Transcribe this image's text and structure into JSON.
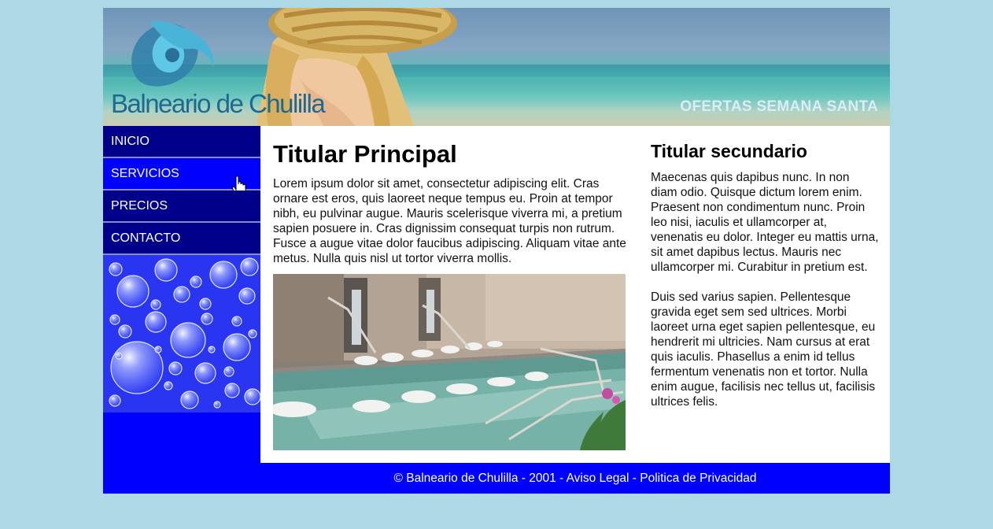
{
  "header": {
    "logo_text": "Balneario de Chulilla",
    "offers_link": "OFERTAS SEMANA SANTA"
  },
  "nav": {
    "items": [
      {
        "label": "INICIO",
        "active": false
      },
      {
        "label": "SERVICIOS",
        "active": true
      },
      {
        "label": "PRECIOS",
        "active": false
      },
      {
        "label": "CONTACTO",
        "active": false
      }
    ]
  },
  "main": {
    "title": "Titular Principal",
    "paragraph": "Lorem ipsum dolor sit amet, consectetur adipiscing elit. Cras ornare est eros, quis laoreet neque tempus eu. Proin at tempor nibh, eu pulvinar augue. Mauris scelerisque viverra mi, a pretium sapien posuere in. Cras dignissim consequat turpis non rutrum. Fusce a augue vitae dolor faucibus adipiscing. Aliquam vitae ante metus. Nulla quis nisl ut tortor viverra mollis."
  },
  "aside": {
    "title": "Titular secundario",
    "paragraphs": [
      "Maecenas quis dapibus nunc. In non diam odio. Quisque dictum lorem enim. Praesent non condimentum nunc. Proin leo nisi, iaculis et ullamcorper at, venenatis eu dolor. Integer eu mattis urna, sit amet dapibus lectus. Mauris nec ullamcorper mi. Curabitur in pretium est.",
      "Duis sed varius sapien. Pellentesque gravida eget sem sed ultrices. Morbi laoreet urna eget sapien pellentesque, eu hendrerit mi ultricies. Nam cursus at erat quis iaculis. Phasellus a enim id tellus fermentum venenatis non et tortor. Nulla enim augue, facilisis nec tellus ut, facilisis ultrices felis."
    ]
  },
  "footer": {
    "text": "© Balneario de Chulilla - 2001 - Aviso Legal - Politica de Privacidad"
  },
  "colors": {
    "background": "#add8e6",
    "nav_bg": "#00008b",
    "nav_active": "#0000ff",
    "footer_bg": "#0000ff"
  },
  "icons": {
    "logo": "swirl-logo-icon",
    "cursor": "hand-pointer-icon"
  }
}
